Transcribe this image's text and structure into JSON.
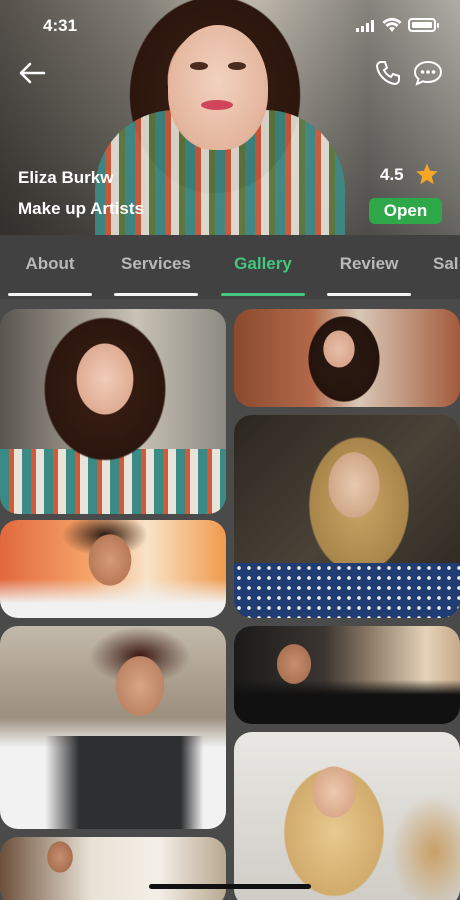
{
  "status_bar": {
    "time": "4:31"
  },
  "profile": {
    "name": "Eliza Burkw",
    "profession": "Make up Artists",
    "rating": "4.5",
    "status": "Open"
  },
  "header_icons": [
    "back-arrow-icon",
    "phone-icon",
    "chat-bubble-icon"
  ],
  "tabs": [
    {
      "label": "About",
      "active": false
    },
    {
      "label": "Services",
      "active": false
    },
    {
      "label": "Gallery",
      "active": true
    },
    {
      "label": "Review",
      "active": false
    },
    {
      "label": "Sal",
      "active": false
    }
  ],
  "colors": {
    "accent": "#43c77f",
    "open_badge": "#2fa84a",
    "star": "#f5a623",
    "tab_bar": "#414141",
    "background": "#4a4a4a"
  }
}
